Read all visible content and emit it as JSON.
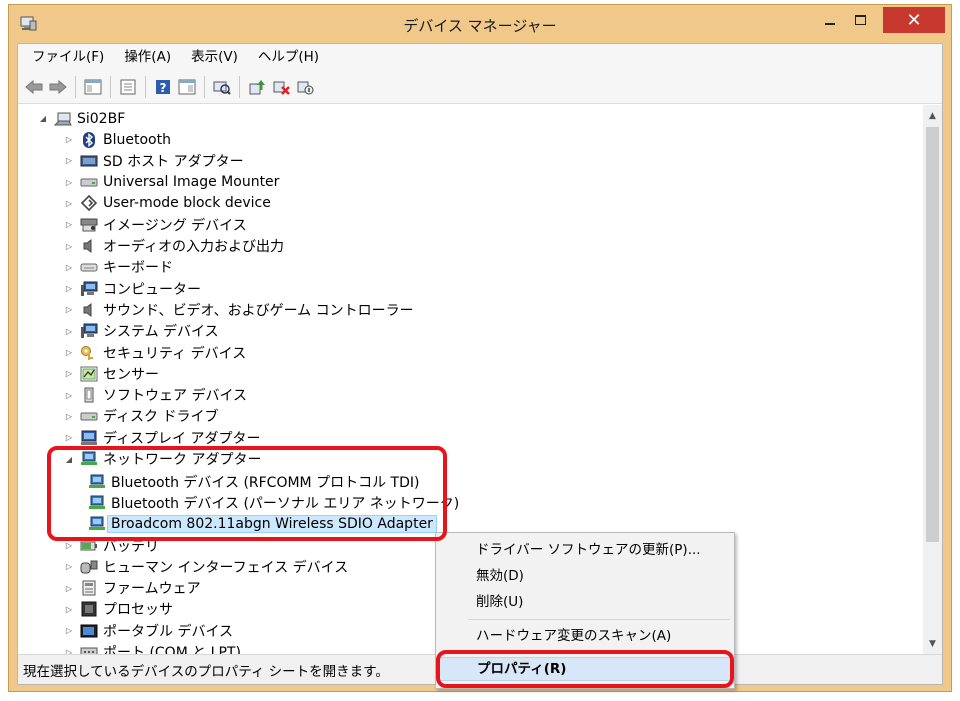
{
  "window": {
    "title": "デバイス マネージャー"
  },
  "menubar": {
    "items": [
      "ファイル(F)",
      "操作(A)",
      "表示(V)",
      "ヘルプ(H)"
    ]
  },
  "toolbar": {
    "buttons": [
      "back-arrow-icon",
      "forward-arrow-icon",
      "show-hide-console-tree-icon",
      "properties-icon",
      "help-icon",
      "action-pane-icon",
      "scan-hardware-icon",
      "update-driver-icon",
      "uninstall-icon",
      "disable-icon"
    ]
  },
  "tree": {
    "root": "Si02BF",
    "items": [
      {
        "label": "Bluetooth",
        "icon": "bluetooth-icon"
      },
      {
        "label": "SD ホスト アダプター",
        "icon": "sd-host-icon"
      },
      {
        "label": "Universal Image Mounter",
        "icon": "disk-icon"
      },
      {
        "label": "User-mode block device",
        "icon": "block-device-icon"
      },
      {
        "label": "イメージング デバイス",
        "icon": "imaging-icon"
      },
      {
        "label": "オーディオの入力および出力",
        "icon": "speaker-icon"
      },
      {
        "label": "キーボード",
        "icon": "keyboard-icon"
      },
      {
        "label": "コンピューター",
        "icon": "computer-icon"
      },
      {
        "label": "サウンド、ビデオ、およびゲーム コントローラー",
        "icon": "speaker-icon"
      },
      {
        "label": "システム デバイス",
        "icon": "computer-icon"
      },
      {
        "label": "セキュリティ デバイス",
        "icon": "key-icon"
      },
      {
        "label": "センサー",
        "icon": "sensor-icon"
      },
      {
        "label": "ソフトウェア デバイス",
        "icon": "software-device-icon"
      },
      {
        "label": "ディスク ドライブ",
        "icon": "disk-icon"
      },
      {
        "label": "ディスプレイ アダプター",
        "icon": "display-icon"
      },
      {
        "label": "ネットワーク アダプター",
        "icon": "network-icon"
      }
    ],
    "network_children": [
      "Bluetooth デバイス (RFCOMM プロトコル TDI)",
      "Bluetooth デバイス (パーソナル エリア ネットワーク)",
      "Broadcom 802.11abgn Wireless SDIO Adapter"
    ],
    "items_after": [
      {
        "label": "バッテリ",
        "icon": "battery-icon"
      },
      {
        "label": "ヒューマン インターフェイス デバイス",
        "icon": "hid-icon"
      },
      {
        "label": "ファームウェア",
        "icon": "firmware-icon"
      },
      {
        "label": "プロセッサ",
        "icon": "processor-icon"
      },
      {
        "label": "ポータブル デバイス",
        "icon": "portable-icon"
      },
      {
        "label": "ポート (COM と LPT)",
        "icon": "port-icon"
      }
    ]
  },
  "context_menu": {
    "items": [
      "ドライバー ソフトウェアの更新(P)...",
      "無効(D)",
      "削除(U)",
      "ハードウェア変更のスキャン(A)",
      "プロパティ(R)"
    ]
  },
  "statusbar": {
    "text": "現在選択しているデバイスのプロパティ シートを開きます。"
  },
  "colors": {
    "titlebar": "#f0c98a",
    "close_button": "#c7382e",
    "selection": "#cce8ff",
    "annotation": "#e8141c"
  }
}
